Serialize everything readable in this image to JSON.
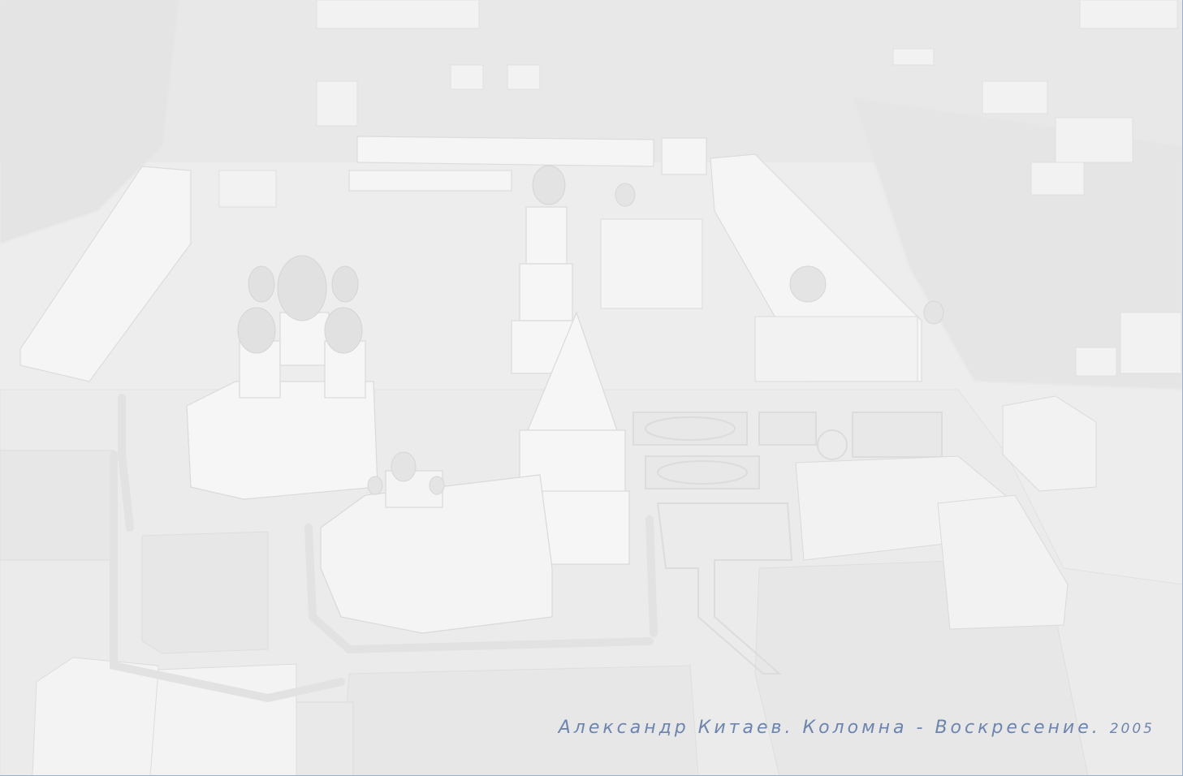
{
  "caption": {
    "text": "Александр Китаев. Коломна - Воскресение.",
    "year": "2005"
  },
  "colors": {
    "caption": "#6d85ae",
    "background": "#efefef",
    "border": "#9ab0cf"
  }
}
